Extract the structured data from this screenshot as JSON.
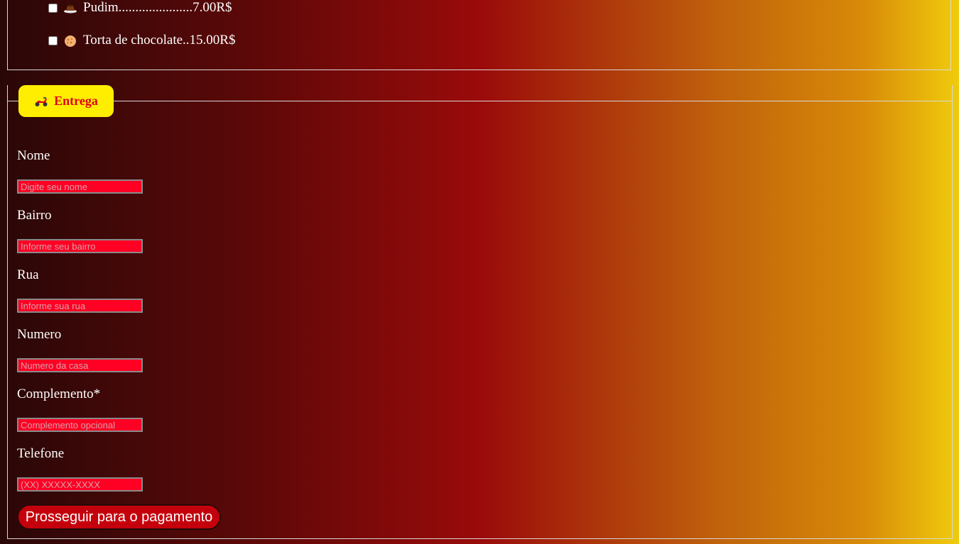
{
  "menu": {
    "items": [
      {
        "icon": "pudding-icon",
        "label": "Pudim......................7.00R$"
      },
      {
        "icon": "cookie-icon",
        "label": "Torta de chocolate..15.00R$"
      }
    ]
  },
  "entrega": {
    "legend": "Entrega",
    "legend_icon": "scooter-icon",
    "fields": [
      {
        "label": "Nome",
        "placeholder": "Digite seu nome"
      },
      {
        "label": "Bairro",
        "placeholder": "Informe seu bairro"
      },
      {
        "label": "Rua",
        "placeholder": "Informe sua rua"
      },
      {
        "label": "Numero",
        "placeholder": "Numero da casa"
      },
      {
        "label": "Complemento*",
        "placeholder": "Complemento opcional"
      },
      {
        "label": "Telefone",
        "placeholder": "(XX) XXXXX-XXXX"
      }
    ],
    "submit_label": "Prosseguir para o pagamento"
  },
  "colors": {
    "legend_bg": "#ffee00",
    "legend_text": "#e0001a",
    "input_bg": "#ff0024",
    "button_bg": "#c4000c"
  }
}
